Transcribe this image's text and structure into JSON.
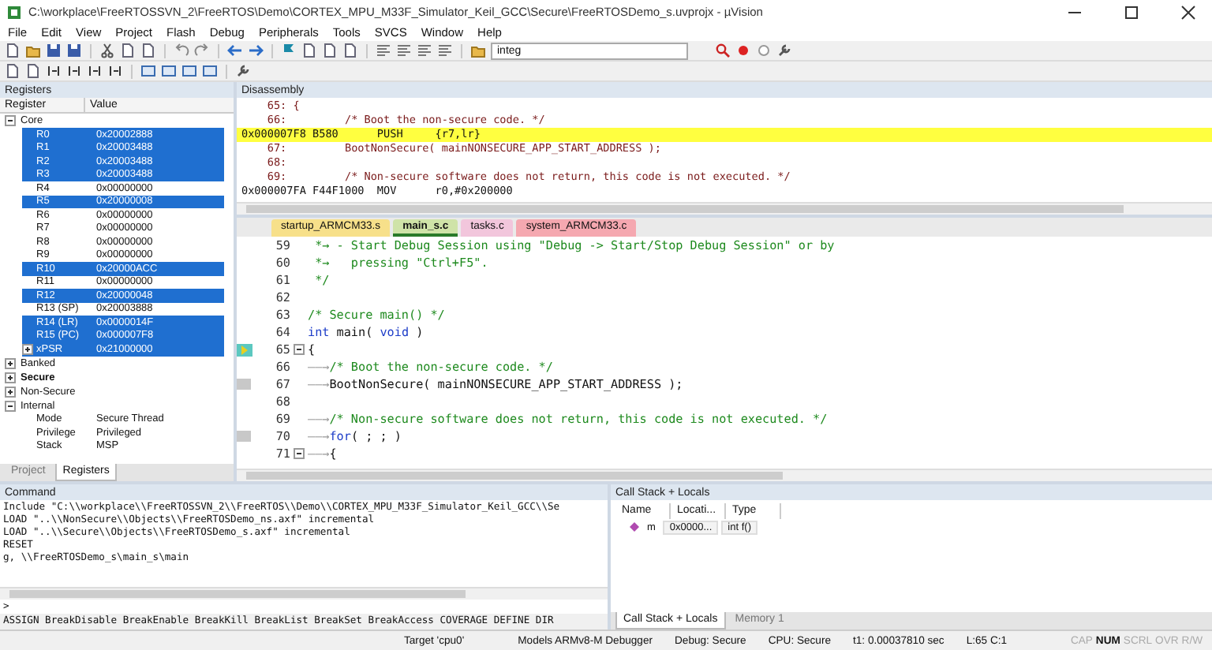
{
  "window": {
    "title": "C:\\workplace\\FreeRTOSSVN_2\\FreeRTOS\\Demo\\CORTEX_MPU_M33F_Simulator_Keil_GCC\\Secure\\FreeRTOSDemo_s.uvprojx - µVision"
  },
  "menu": [
    "File",
    "Edit",
    "View",
    "Project",
    "Flash",
    "Debug",
    "Peripherals",
    "Tools",
    "SVCS",
    "Window",
    "Help"
  ],
  "toolbar": {
    "target_field": "integ"
  },
  "registers": {
    "title": "Registers",
    "columns": [
      "Register",
      "Value"
    ],
    "tree": [
      {
        "label": "Core",
        "expanded": true,
        "bold": false,
        "children": [
          {
            "label": "R0",
            "value": "0x20002888",
            "selected": true,
            "kind": "register"
          },
          {
            "label": "R1",
            "value": "0x20003488",
            "selected": true,
            "kind": "register"
          },
          {
            "label": "R2",
            "value": "0x20003488",
            "selected": true,
            "kind": "register"
          },
          {
            "label": "R3",
            "value": "0x20003488",
            "selected": true,
            "kind": "register"
          },
          {
            "label": "R4",
            "value": "0x00000000",
            "selected": false,
            "kind": "register"
          },
          {
            "label": "R5",
            "value": "0x20000008",
            "selected": true,
            "kind": "register"
          },
          {
            "label": "R6",
            "value": "0x00000000",
            "selected": false,
            "kind": "register"
          },
          {
            "label": "R7",
            "value": "0x00000000",
            "selected": false,
            "kind": "register"
          },
          {
            "label": "R8",
            "value": "0x00000000",
            "selected": false,
            "kind": "register"
          },
          {
            "label": "R9",
            "value": "0x00000000",
            "selected": false,
            "kind": "register"
          },
          {
            "label": "R10",
            "value": "0x20000ACC",
            "selected": true,
            "kind": "register"
          },
          {
            "label": "R11",
            "value": "0x00000000",
            "selected": false,
            "kind": "register"
          },
          {
            "label": "R12",
            "value": "0x20000048",
            "selected": true,
            "kind": "register"
          },
          {
            "label": "R13 (SP)",
            "value": "0x20003888",
            "selected": false,
            "kind": "register"
          },
          {
            "label": "R14 (LR)",
            "value": "0x0000014F",
            "selected": true,
            "kind": "register"
          },
          {
            "label": "R15 (PC)",
            "value": "0x000007F8",
            "selected": true,
            "kind": "register"
          },
          {
            "label": "xPSR",
            "value": "0x21000000",
            "selected": true,
            "kind": "group"
          }
        ]
      },
      {
        "label": "Banked",
        "expanded": false,
        "bold": false
      },
      {
        "label": "Secure",
        "expanded": false,
        "bold": true
      },
      {
        "label": "Non-Secure",
        "expanded": false,
        "bold": false
      },
      {
        "label": "Internal",
        "expanded": true,
        "bold": false,
        "children": [
          {
            "label": "Mode",
            "value": "Secure Thread",
            "selected": false,
            "kind": "register"
          },
          {
            "label": "Privilege",
            "value": "Privileged",
            "selected": false,
            "kind": "register"
          },
          {
            "label": "Stack",
            "value": "MSP",
            "selected": false,
            "kind": "register"
          }
        ]
      }
    ],
    "tabs": [
      {
        "label": "Project",
        "selected": false
      },
      {
        "label": "Registers",
        "selected": true
      }
    ]
  },
  "disassembly": {
    "title": "Disassembly",
    "lines": [
      {
        "text": "    65: {",
        "kind": "source",
        "selected": false
      },
      {
        "text": "    66:         /* Boot the non-secure code. */",
        "kind": "source",
        "selected": false
      },
      {
        "text": "0x000007F8 B580      PUSH     {r7,lr}",
        "kind": "asm",
        "selected": true
      },
      {
        "text": "    67:         BootNonSecure( mainNONSECURE_APP_START_ADDRESS );",
        "kind": "source",
        "selected": false
      },
      {
        "text": "    68: ",
        "kind": "source",
        "selected": false
      },
      {
        "text": "    69:         /* Non-secure software does not return, this code is not executed. */",
        "kind": "source",
        "selected": false
      },
      {
        "text": "0x000007FA F44F1000  MOV      r0,#0x200000",
        "kind": "asm",
        "selected": false
      }
    ]
  },
  "editor": {
    "tabs": [
      {
        "label": "startup_ARMCM33.s",
        "selected": false,
        "color": "#f7e08a"
      },
      {
        "label": "main_s.c",
        "selected": true,
        "color": "#cfe3a8"
      },
      {
        "label": "tasks.c",
        "selected": false,
        "color": "#f2c6dc"
      },
      {
        "label": "system_ARMCM33.c",
        "selected": false,
        "color": "#f5a8b0"
      }
    ],
    "lines": [
      {
        "number": "59",
        "kind": "plain",
        "fold": false,
        "segments": [
          {
            "text": " *→ - Start Debug Session using \"Debug -> Start/Stop Debug Session\" or by",
            "kind": "comment"
          }
        ]
      },
      {
        "number": "60",
        "kind": "plain",
        "fold": false,
        "segments": [
          {
            "text": " *→   pressing \"Ctrl+F5\".",
            "kind": "comment"
          }
        ]
      },
      {
        "number": "61",
        "kind": "plain",
        "fold": false,
        "segments": [
          {
            "text": " */",
            "kind": "comment"
          }
        ]
      },
      {
        "number": "62",
        "kind": "plain",
        "fold": false
      },
      {
        "number": "63",
        "kind": "plain",
        "fold": false,
        "segments": [
          {
            "text": "/* Secure main() */",
            "kind": "comment"
          }
        ]
      },
      {
        "number": "64",
        "kind": "plain",
        "fold": false,
        "segments": [
          {
            "text": "int",
            "kind": "keyword"
          },
          {
            "text": " main( ",
            "kind": "plain"
          },
          {
            "text": "void",
            "kind": "keyword"
          },
          {
            "text": " )",
            "kind": "plain"
          }
        ]
      },
      {
        "number": "65",
        "kind": "current",
        "fold": true,
        "segments": [
          {
            "text": "{",
            "kind": "plain"
          }
        ]
      },
      {
        "number": "66",
        "kind": "plain",
        "fold": false,
        "segments": [
          {
            "text": "——→",
            "kind": "whitespace"
          },
          {
            "text": "/* Boot the non-secure code. */",
            "kind": "comment"
          }
        ]
      },
      {
        "number": "67",
        "kind": "code",
        "fold": false,
        "segments": [
          {
            "text": "——→",
            "kind": "whitespace"
          },
          {
            "text": "BootNonSecure( mainNONSECURE_APP_START_ADDRESS );",
            "kind": "plain"
          }
        ]
      },
      {
        "number": "68",
        "kind": "plain",
        "fold": false
      },
      {
        "number": "69",
        "kind": "plain",
        "fold": false,
        "segments": [
          {
            "text": "——→",
            "kind": "whitespace"
          },
          {
            "text": "/* Non-secure software does not return, this code is not executed. */",
            "kind": "comment"
          }
        ]
      },
      {
        "number": "70",
        "kind": "code",
        "fold": false,
        "segments": [
          {
            "text": "——→",
            "kind": "whitespace"
          },
          {
            "text": "for",
            "kind": "keyword"
          },
          {
            "text": "( ; ; )",
            "kind": "plain"
          }
        ]
      },
      {
        "number": "71",
        "kind": "plain",
        "fold": true,
        "segments": [
          {
            "text": "——→",
            "kind": "whitespace"
          },
          {
            "text": "{",
            "kind": "plain"
          }
        ]
      }
    ]
  },
  "command": {
    "title": "Command",
    "output": [
      "Include \"C:\\\\workplace\\\\FreeRTOSSVN_2\\\\FreeRTOS\\\\Demo\\\\CORTEX_MPU_M33F_Simulator_Keil_GCC\\\\Se",
      "LOAD \"..\\\\NonSecure\\\\Objects\\\\FreeRTOSDemo_ns.axf\" incremental",
      "LOAD \"..\\\\Secure\\\\Objects\\\\FreeRTOSDemo_s.axf\" incremental",
      "RESET",
      "g, \\\\FreeRTOSDemo_s\\main_s\\main"
    ],
    "prompt": ">",
    "hints": "ASSIGN BreakDisable BreakEnable BreakKill BreakList BreakSet BreakAccess COVERAGE DEFINE DIR"
  },
  "call_stack": {
    "title": "Call Stack + Locals",
    "columns": [
      "Name",
      "Locati...",
      "Type"
    ],
    "rows": [
      {
        "name": "m",
        "location": "0x0000...",
        "type": "int f()"
      }
    ],
    "tabs": [
      {
        "label": "Call Stack + Locals",
        "selected": true
      },
      {
        "label": "Memory 1",
        "selected": false
      }
    ]
  },
  "status_bar": {
    "items": [
      "Target 'cpu0'",
      "Models ARMv8-M Debugger",
      "Debug: Secure",
      "CPU: Secure",
      "t1: 0.00037810 sec",
      "L:65 C:1"
    ],
    "indicators": [
      {
        "label": "CAP",
        "on": false
      },
      {
        "label": "NUM",
        "on": true
      },
      {
        "label": "SCRL",
        "on": false
      },
      {
        "label": "OVR",
        "on": false
      },
      {
        "label": "R/W",
        "on": false
      }
    ]
  }
}
